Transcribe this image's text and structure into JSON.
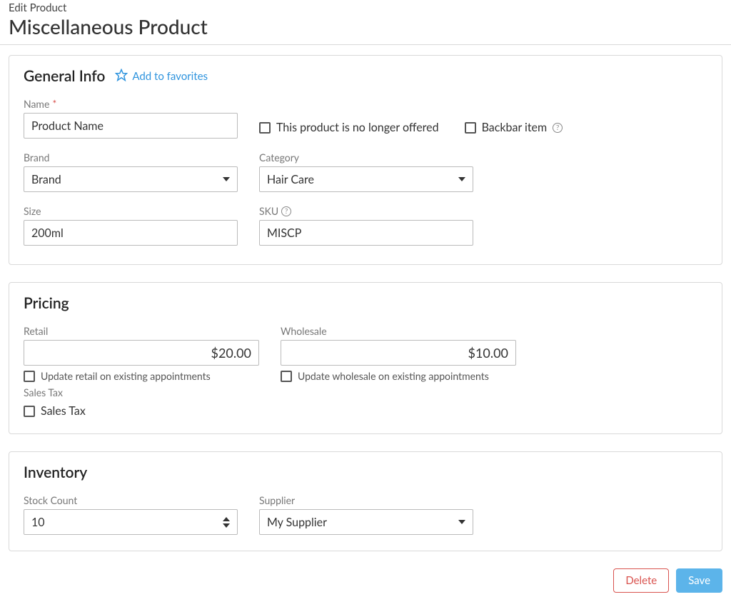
{
  "breadcrumb": "Edit Product",
  "page_title": "Miscellaneous Product",
  "general": {
    "title": "General Info",
    "favorites_link": "Add to favorites",
    "name_label": "Name",
    "name_value": "Product Name",
    "no_longer_offered_label": "This product is no longer offered",
    "backbar_label": "Backbar item",
    "brand_label": "Brand",
    "brand_value": "Brand",
    "category_label": "Category",
    "category_value": "Hair Care",
    "size_label": "Size",
    "size_value": "200ml",
    "sku_label": "SKU",
    "sku_value": "MISCP"
  },
  "pricing": {
    "title": "Pricing",
    "retail_label": "Retail",
    "retail_value": "$20.00",
    "retail_update_label": "Update retail on existing appointments",
    "wholesale_label": "Wholesale",
    "wholesale_value": "$10.00",
    "wholesale_update_label": "Update wholesale on existing appointments",
    "sales_tax_section": "Sales Tax",
    "sales_tax_checkbox_label": "Sales Tax"
  },
  "inventory": {
    "title": "Inventory",
    "stock_label": "Stock Count",
    "stock_value": "10",
    "supplier_label": "Supplier",
    "supplier_value": "My Supplier"
  },
  "buttons": {
    "delete": "Delete",
    "save": "Save"
  }
}
